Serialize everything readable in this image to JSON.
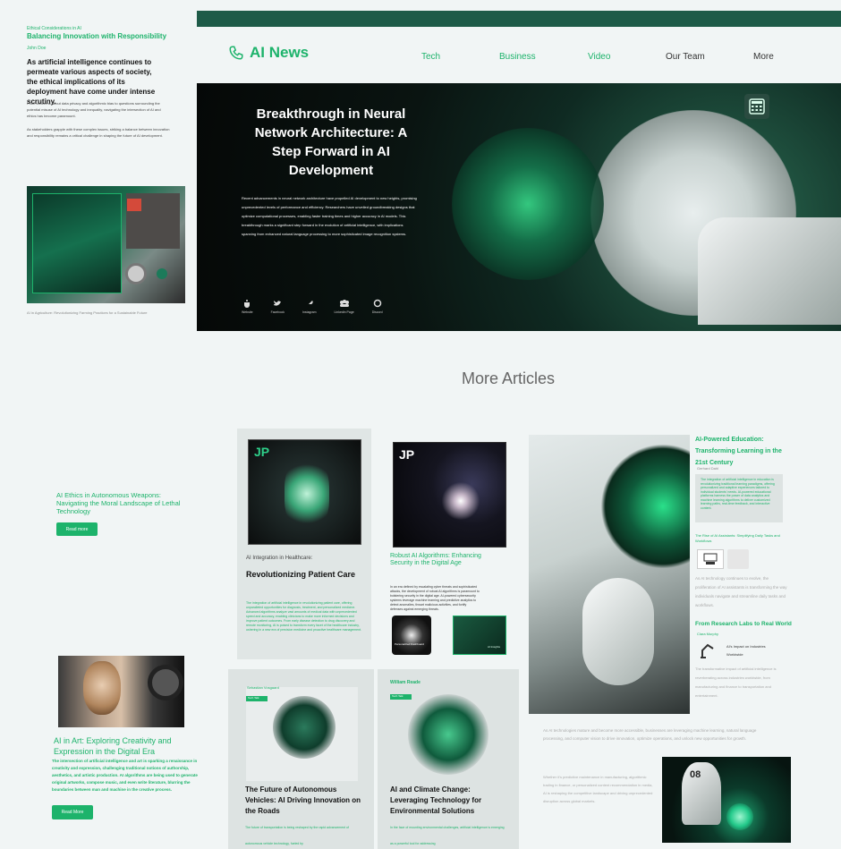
{
  "left_column": {
    "kicker": "Ethical Considerations in AI",
    "title": "Balancing Innovation with Responsibility",
    "author": "John Doe",
    "lead": "As artificial intelligence continues to permeate various aspects of society, the ethical implications of its deployment have come under intense scrutiny.",
    "para1": "From concerns about data privacy and algorithmic bias to questions surrounding the potential misuse of AI technology and inequality, navigating the intersection of AI and ethics has become paramount.",
    "para2": "As stakeholders grapple with these complex issues, striking a balance between innovation and responsibility remains a critical challenge in shaping the future of AI development.",
    "image_caption": "AI in Agriculture: Revolutionizing Farming Practices for a Sustainable Future",
    "card1_title": "AI Ethics in Autonomous Weapons: Navigating the Moral Landscape of Lethal Technology",
    "card1_button": "Read more",
    "card2_title": "AI in Art: Exploring Creativity and Expression in the Digital Era",
    "card2_body": "The intersection of artificial intelligence and art is sparking a renaissance in creativity and expression, challenging traditional notions of authorship, aesthetics, and artistic production. AI algorithms are being used to generate original artworks, compose music, and even write literature, blurring the boundaries between man and machine in the creative process.",
    "card2_button": "Read More"
  },
  "header": {
    "logo": "AI News",
    "nav": [
      "Tech",
      "Business",
      "Video",
      "Our Team",
      "More"
    ]
  },
  "hero": {
    "title": "Breakthrough in Neural Network Architecture: A Step Forward in AI Development",
    "body": "Recent advancements in neural network architecture have propelled AI development to new heights, promising unprecedented levels of performance and efficiency. Researchers have unveiled groundbreaking designs that optimize computational processes, enabling faster training times and higher accuracy in AI models. This breakthrough marks a significant step forward in the evolution of artificial intelligence, with implications spanning from enhanced natural language processing to more sophisticated image recognition systems.",
    "icons": [
      "Website",
      "Facebook",
      "Instagram",
      "Linkedin Page",
      "Discord"
    ]
  },
  "more_articles": {
    "heading": "More Articles",
    "healthcare": {
      "kicker": "AI Integration in Healthcare:",
      "title": "Revolutionizing Patient Care",
      "body": "The integration of artificial intelligence in revolutionizing patient care, offering unparalleled opportunities for diagnosis, treatment, and personalized medicine. Advanced algorithms analyze vast amounts of medical data with unprecedented speed and accuracy, enabling clinicians to make more informed decisions and improve patient outcomes. From early disease detection to drug discovery and remote monitoring, AI is poised to transform every facet of the healthcare industry, ushering in a new era of precision medicine and proactive healthcare management."
    },
    "security": {
      "title": "Robust AI Algorithms: Enhancing Security in the Digital Age",
      "body": "In an era defined by escalating cyber threats and sophisticated attacks, the development of robust AI algorithms is paramount to bolstering security in the digital age. AI-powered cybersecurity systems leverage machine learning and predictive analytics to detect anomalies, thwart malicious activities, and fortify defenses against emerging threats.",
      "thumb1_label": "Personalized Dashboard",
      "thumb2_label": "AI Insights"
    },
    "autonomous": {
      "author": "Sebastian Vosgaard",
      "tag": "Tech Talk",
      "title": "The Future of Autonomous Vehicles: AI Driving Innovation on the Roads",
      "body": "The future of transportation is being reshaped by the rapid advancement of autonomous vehicle technology, fueled by"
    },
    "climate": {
      "author": "William Reade",
      "tag": "Tech Talk",
      "title": "AI and Climate Change: Leveraging Technology for Environmental Solutions",
      "body": "In the face of mounting environmental challenges, artificial intelligence is emerging as a powerful tool for addressing"
    },
    "education": {
      "title": "AI-Powered Education: Transforming Learning in the 21st Century",
      "author": "Gerhard Dahl",
      "quote": "The integration of artificial intelligence in education is revolutionizing traditional learning paradigms, offering personalized and adaptive experiences tailored to individual students' needs. AI-powered educational platforms harness the power of data analytics and machine learning algorithms to deliver customized learning paths, real-time feedback, and interactive content.",
      "assistants_title": "The Rise of AI Assistants: Simplifying Daily Tasks and Workflows",
      "assistants_body": "As AI technology continues to evolve, the proliferation of AI assistants is transforming the way individuals navigate and streamline daily tasks and workflows.",
      "research_title": "From Research Labs to Real World",
      "research_author": "Clara Murphy",
      "impact_label": "AI's Impact on Industries Worldwide",
      "impact_body": "The transformative impact of artificial intelligence is reverberating across industries worldwide, from manufacturing and finance to transportation and entertainment."
    },
    "bottom_para1": "As AI technologies mature and become more accessible, businesses are leveraging machine learning, natural language processing, and computer vision to drive innovation, optimize operations, and unlock new opportunities for growth.",
    "bottom_para2": "Whether it's predictive maintenance in manufacturing, algorithmic trading in finance, or personalized content recommendation in media, AI is reshaping the competitive landscape and driving unprecedented disruption across global markets.",
    "jersey_number": "08"
  },
  "colors": {
    "accent": "#1db36b",
    "dark_bar": "#1e5b48",
    "page_bg": "#f1f5f5"
  }
}
